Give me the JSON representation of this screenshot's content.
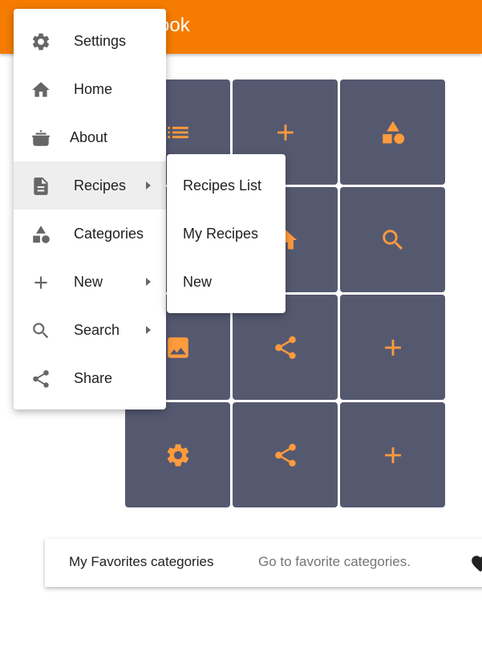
{
  "app": {
    "title": "ok Book"
  },
  "colors": {
    "toolbar": "#f57c00",
    "tile": "#555970",
    "tile_icon": "#ff9b3d",
    "menu_icon": "#666666"
  },
  "grid": {
    "tiles": [
      {
        "icon": "list-icon"
      },
      {
        "icon": "plus-icon"
      },
      {
        "icon": "shapes-icon"
      },
      {
        "icon": "home-icon"
      },
      {
        "icon": "search-icon"
      },
      {
        "icon": "image-icon"
      },
      {
        "icon": "share-icon"
      },
      {
        "icon": "plus-icon"
      },
      {
        "icon": "gear-icon"
      },
      {
        "icon": "share-icon"
      },
      {
        "icon": "plus-icon"
      }
    ]
  },
  "favorites": {
    "title": "My Favorites categories",
    "subtitle": "Go to favorite categories.",
    "icon": "heart-icon"
  },
  "menu": {
    "items": [
      {
        "label": "Settings",
        "icon": "gear-icon",
        "has_submenu": false
      },
      {
        "label": "Home",
        "icon": "home-icon",
        "has_submenu": false
      },
      {
        "label": "About",
        "icon": "pot-icon",
        "has_submenu": false
      },
      {
        "label": "Recipes",
        "icon": "document-icon",
        "has_submenu": true,
        "active": true
      },
      {
        "label": "Categories",
        "icon": "shapes-icon",
        "has_submenu": false
      },
      {
        "label": "New",
        "icon": "plus-icon",
        "has_submenu": true
      },
      {
        "label": "Search",
        "icon": "search-icon",
        "has_submenu": true
      },
      {
        "label": "Share",
        "icon": "share-icon",
        "has_submenu": false
      }
    ]
  },
  "submenu": {
    "items": [
      {
        "label": "Recipes List"
      },
      {
        "label": "My Recipes"
      },
      {
        "label": "New"
      }
    ]
  }
}
